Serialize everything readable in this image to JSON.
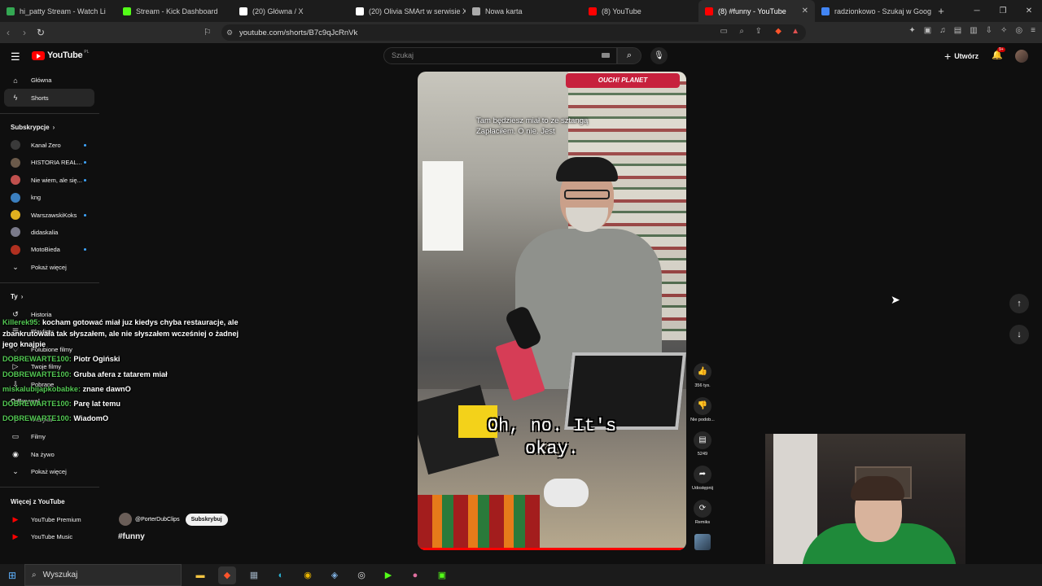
{
  "browser": {
    "tabs": [
      {
        "label": "hi_patty Stream - Watch Li",
        "color": "#34a853"
      },
      {
        "label": "Stream - Kick Dashboard",
        "color": "#53fc18"
      },
      {
        "label": "(20) Główna / X",
        "color": "#ffffff"
      },
      {
        "label": "(20) Olivia SMArt w serwisie X",
        "color": "#ffffff"
      },
      {
        "label": "Nowa karta",
        "color": "#aaaaaa"
      },
      {
        "label": "(8) YouTube",
        "color": "#ff0000"
      },
      {
        "label": "(8) #funny - YouTube",
        "color": "#ff0000",
        "active": true
      },
      {
        "label": "radzionkowo - Szukaj w Googl",
        "color": "#4285f4"
      }
    ],
    "url": "youtube.com/shorts/B7c9qJcRnVk"
  },
  "youtube": {
    "logo_text": "YouTube",
    "logo_region": "PL",
    "search_placeholder": "Szukaj",
    "create_label": "Utwórz",
    "notification_count": "9+"
  },
  "sidebar": {
    "main": [
      {
        "label": "Główna",
        "icon": "home-icon"
      },
      {
        "label": "Shorts",
        "icon": "shorts-icon",
        "active": true
      }
    ],
    "subscriptions_title": "Subskrypcje",
    "subscriptions": [
      {
        "label": "Kanał Zero",
        "color": "#3a3a3a"
      },
      {
        "label": "HISTORIA REAL...",
        "color": "#6b5a4a"
      },
      {
        "label": "Nie wiem, ale się...",
        "color": "#c0504d"
      },
      {
        "label": "kng",
        "color": "#3b7fbf"
      },
      {
        "label": "WarszawskiKoks",
        "color": "#e0b020"
      },
      {
        "label": "didaskalia",
        "color": "#7a7a8a"
      },
      {
        "label": "MotoBieda",
        "color": "#b03020"
      }
    ],
    "show_more": "Pokaż więcej",
    "you_title": "Ty",
    "you_items": [
      {
        "label": "Historia",
        "icon": "history-icon"
      },
      {
        "label": "Playlisty",
        "icon": "playlist-icon"
      },
      {
        "label": "Polubione filmy",
        "icon": "like-icon"
      },
      {
        "label": "Twoje filmy",
        "icon": "video-icon"
      },
      {
        "label": "Pobrane",
        "icon": "download-icon"
      }
    ],
    "explore_title": "Odkrywaj",
    "explore_items": [
      {
        "label": "Muzyka",
        "icon": "music-icon"
      },
      {
        "label": "Filmy",
        "icon": "film-icon"
      },
      {
        "label": "Na żywo",
        "icon": "live-icon"
      }
    ],
    "more_title": "Więcej z YouTube",
    "more_items": [
      {
        "label": "YouTube Premium"
      },
      {
        "label": "YouTube Music"
      }
    ]
  },
  "chat": [
    {
      "user": "Killerek95",
      "text": "kocham gotować miał juz kiedys chyba restauracje, ale zbankrutowała tak słyszałem, ale nie słyszałem wcześniej o żadnej jego knajpie"
    },
    {
      "user": "DOBREWARTE100",
      "text": "Piotr Ogiński"
    },
    {
      "user": "DOBREWARTE100",
      "text": "Gruba afera z tatarem miał"
    },
    {
      "user": "miskalubijapkobabke",
      "text": "znane dawnO"
    },
    {
      "user": "DOBREWARTE100",
      "text": "Parę lat temu"
    },
    {
      "user": "DOBREWARTE100",
      "text": "WiadomO"
    }
  ],
  "short": {
    "store_banner": "OUCH! PLANET",
    "subtitle_line1": "Tam będziesz miał to ze sztangą",
    "subtitle_line2": "Zapłaciłem.  O nie.  Jest",
    "caption": "Oh, no. It's okay.",
    "channel_name": "@PorterDubClips",
    "subscribe_label": "Subskrybuj",
    "hashtag": "#funny",
    "actions": {
      "like_count": "356 tys.",
      "dislike_label": "Nie podob...",
      "comment_count": "5249",
      "share_label": "Udostępnij",
      "remix_label": "Remiks"
    }
  },
  "taskbar": {
    "search_placeholder": "Wyszukaj"
  }
}
